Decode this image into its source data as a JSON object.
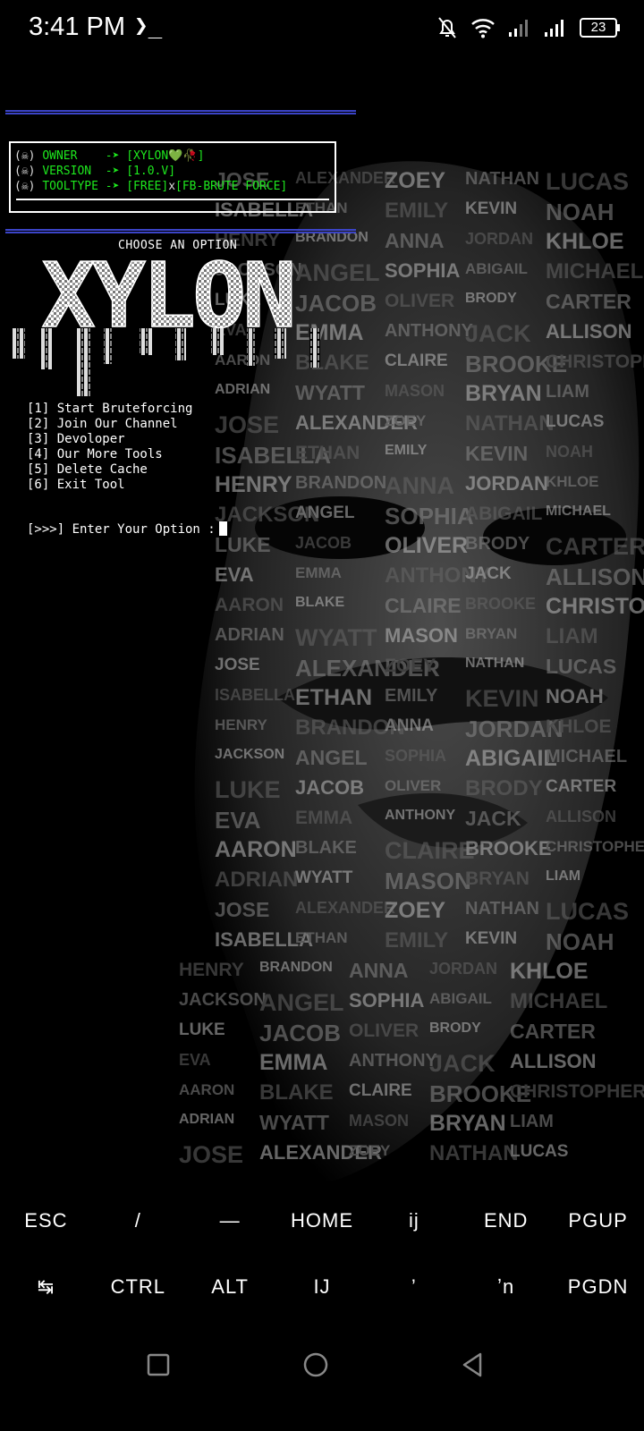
{
  "status_bar": {
    "time": "3:41 PM",
    "terminal_glyph": "❯_",
    "battery": "23"
  },
  "info": {
    "owner_label": "OWNER    -➤ ",
    "owner_value": "[XYLON💚🥀]",
    "version_label": "VERSION  -➤ ",
    "version_value": "[1.0.V]",
    "tooltype_label": "TOOLTYPE -➤ ",
    "tooltype_free": "[FREE]",
    "tooltype_x": "x",
    "tooltype_value": "[FB-BRUTE FORCE]",
    "bullet": "(☠)"
  },
  "choose_label": "CHOOSE AN OPTION",
  "logo_text": "XYLON",
  "menu": [
    "[1] Start Bruteforcing",
    "[2] Join Our Channel",
    "[3] Devoloper",
    "[4] Our More Tools",
    "[5] Delete Cache",
    "[6] Exit Tool"
  ],
  "prompt": "[>>>] Enter Your Option :",
  "extra_keys": {
    "row1": [
      "ESC",
      "/",
      "—",
      "HOME",
      "ij",
      "END",
      "PGUP"
    ],
    "row2": [
      "↹",
      "CTRL",
      "ALT",
      "IJ",
      "’",
      "ʼn",
      "PGDN"
    ]
  },
  "background_words": [
    "JOSE",
    "ALEXANDER",
    "ZOEY",
    "NATHAN",
    "LUCAS",
    "ISABELLA",
    "ETHAN",
    "EMILY",
    "KEVIN",
    "NOAH",
    "HENRY",
    "BRANDON",
    "ANNA",
    "JORDAN",
    "KHLOE",
    "JACKSON",
    "ANGEL",
    "SOPHIA",
    "ABIGAIL",
    "MICHAEL",
    "LUKE",
    "JACOB",
    "OLIVER",
    "BRODY",
    "CARTER",
    "EVA",
    "EMMA",
    "ANTHONY",
    "JACK",
    "ALLISON",
    "AARON",
    "BLAKE",
    "CLAIRE",
    "BROOKE",
    "CHRISTOPHER",
    "ADRIAN",
    "WYATT",
    "MASON",
    "BRYAN",
    "LIAM"
  ],
  "colors": {
    "accent_green": "#1ee81e",
    "rule_blue": "#3b44c7",
    "background": "#000000"
  }
}
